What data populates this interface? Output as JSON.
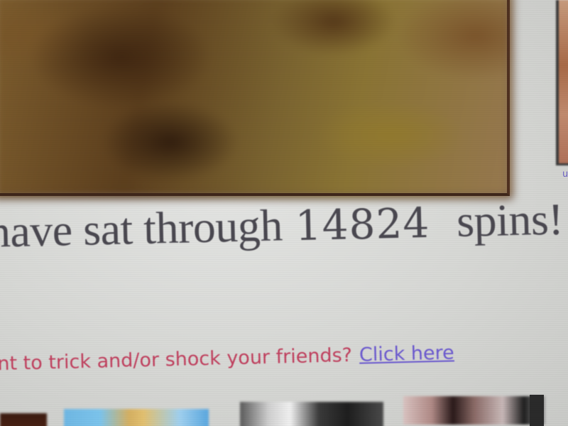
{
  "hero": {
    "image_semantic": "blurred-video-still"
  },
  "counter": {
    "prefix": "have sat through",
    "count": "14824",
    "suffix": "spins!"
  },
  "cta": {
    "text": "nt to trick and/or shock your friends?",
    "link_label": "Click here"
  },
  "side": {
    "link_fragment": "u"
  },
  "colors": {
    "body_text": "#4a4850",
    "cta_text": "#c0405e",
    "link": "#6a58cf",
    "page_background": "#d9dad8",
    "hero_border": "#4e3020"
  }
}
